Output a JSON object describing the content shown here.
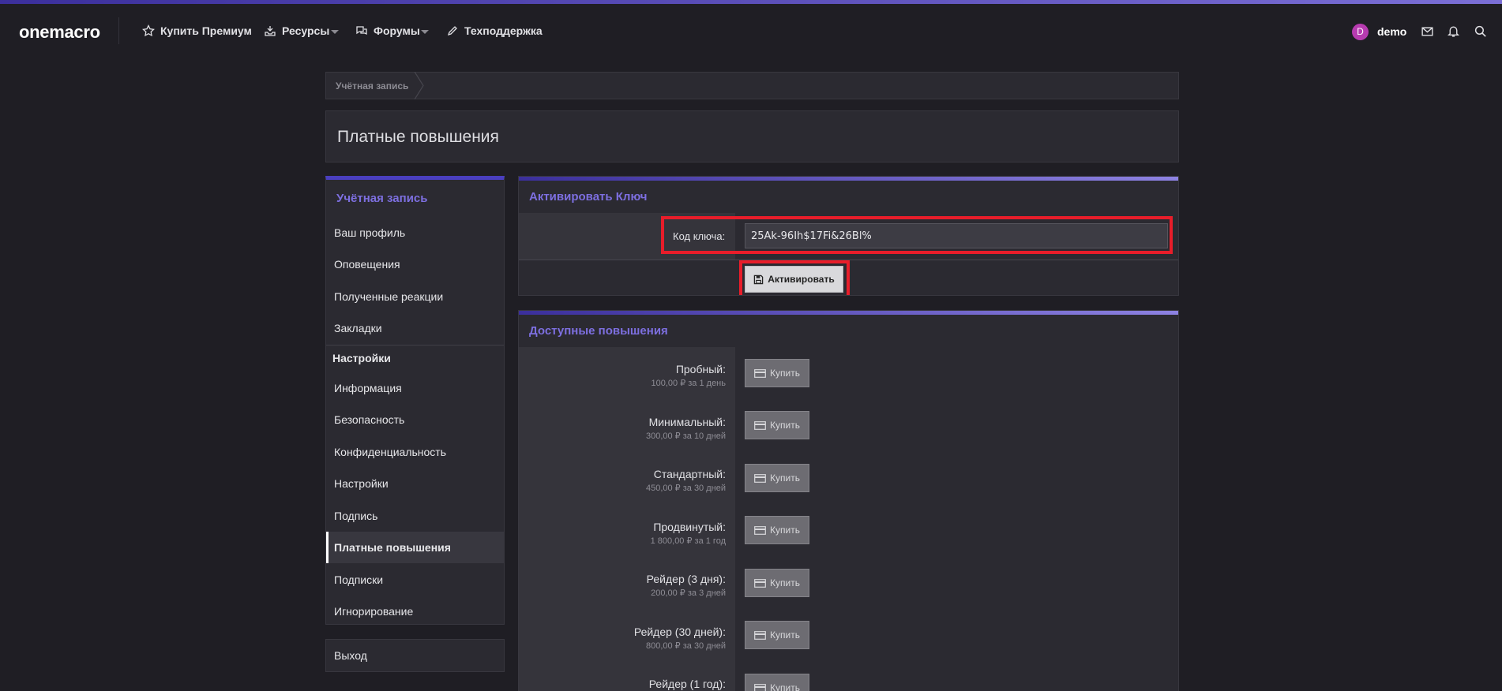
{
  "header": {
    "logo": "onemacro",
    "nav": [
      {
        "label": "Купить Премиум",
        "icon": "star-icon"
      },
      {
        "label": "Ресурсы",
        "icon": "download-tray-icon"
      },
      {
        "label": "Форумы",
        "icon": "chat-bubbles-icon"
      },
      {
        "label": "Техподдержка",
        "icon": "pencil-icon"
      }
    ],
    "user": {
      "avatar_letter": "D",
      "name": "demo",
      "avatar_color": "#b73bb0"
    }
  },
  "breadcrumb": {
    "label": "Учётная запись"
  },
  "page_title": "Платные повышения",
  "sidebar": {
    "heading": "Учётная запись",
    "items": [
      "Ваш профиль",
      "Оповещения",
      "Полученные реакции",
      "Закладки"
    ],
    "section": "Настройки",
    "settings_items": [
      "Информация",
      "Безопасность",
      "Конфиденциальность",
      "Настройки",
      "Подпись",
      "Платные повышения",
      "Подписки",
      "Игнорирование"
    ],
    "active_item": "Платные повышения",
    "logout": "Выход"
  },
  "activate_panel": {
    "title": "Активировать Ключ",
    "key_label": "Код ключа:",
    "key_value": "25Ak-96Ih$17Fi&26Bl%",
    "button_label": "Активировать"
  },
  "upgrades_panel": {
    "title": "Доступные повышения",
    "buy_label": "Купить",
    "items": [
      {
        "name": "Пробный:",
        "price": "100,00 ₽ за 1 день"
      },
      {
        "name": "Минимальный:",
        "price": "300,00 ₽ за 10 дней"
      },
      {
        "name": "Стандартный:",
        "price": "450,00 ₽ за 30 дней"
      },
      {
        "name": "Продвинутый:",
        "price": "1 800,00 ₽ за 1 год"
      },
      {
        "name": "Рейдер (3 дня):",
        "price": "200,00 ₽ за 3 дней"
      },
      {
        "name": "Рейдер (30 дней):",
        "price": "800,00 ₽ за 30 дней"
      },
      {
        "name": "Рейдер (1 год):",
        "price": ""
      }
    ]
  },
  "colors": {
    "accent": "#7d6fe0",
    "highlight": "#e81d2a",
    "background": "#1f1e24"
  }
}
